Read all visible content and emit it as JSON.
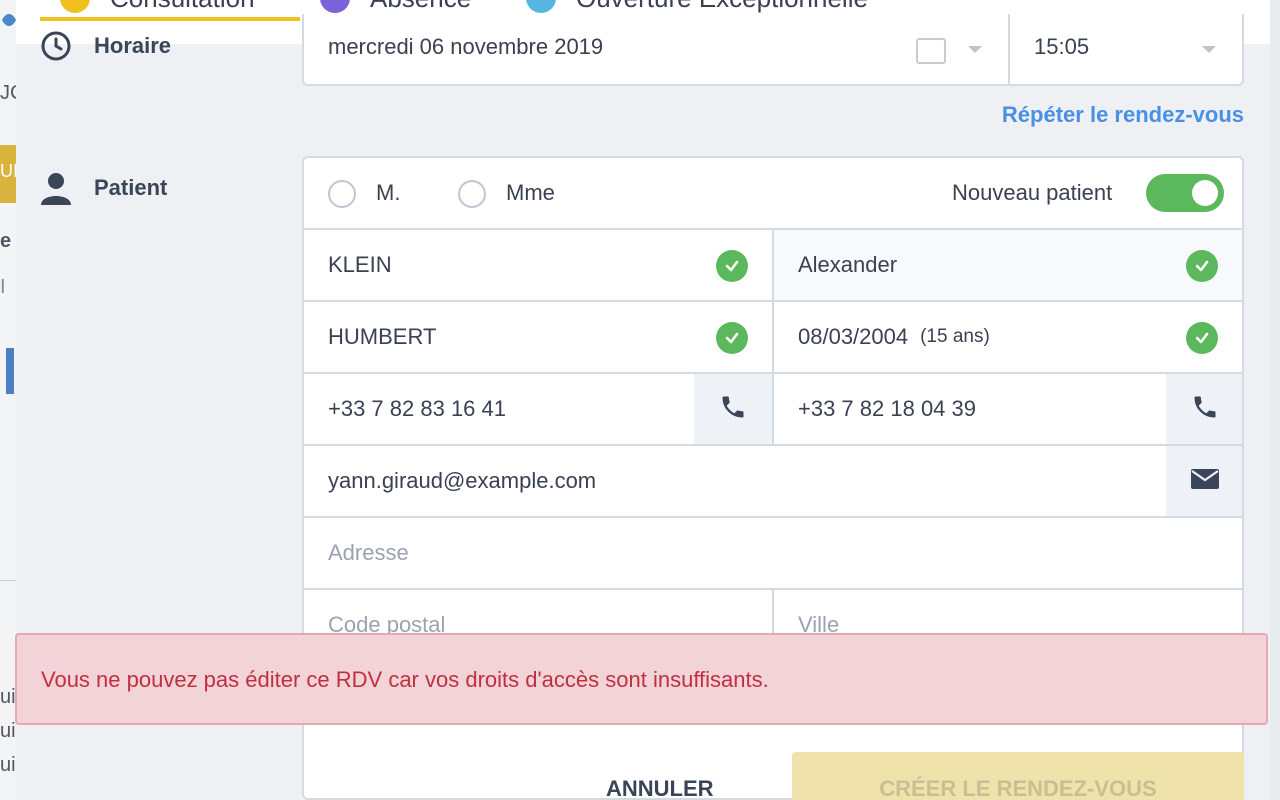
{
  "tabs": [
    {
      "label": "Consultation",
      "color": "#f0c01f"
    },
    {
      "label": "Absence",
      "color": "#7a62d8"
    },
    {
      "label": "Ouverture Exceptionnelle",
      "color": "#56b6e3"
    }
  ],
  "schedule": {
    "label": "Horaire",
    "date": "mercredi 06 novembre 2019",
    "time": "15:05",
    "repeat_link": "Répéter le rendez-vous"
  },
  "patient": {
    "label": "Patient",
    "civility_m": "M.",
    "civility_mme": "Mme",
    "new_patient_label": "Nouveau patient",
    "new_patient_enabled": true,
    "last_name": "KLEIN",
    "first_name": "Alexander",
    "maiden_name": "HUMBERT",
    "birth_date": "08/03/2004",
    "age": "(15 ans)",
    "phone1": "+33 7 82 83 16 41",
    "phone2": "+33 7 82 18 04 39",
    "email": "yann.giraud@example.com",
    "address_placeholder": "Adresse",
    "postal_code_placeholder": "Code postal",
    "city_placeholder": "Ville"
  },
  "alert": {
    "message": "Vous ne pouvez pas éditer ce RDV car vos droits d'accès sont insuffisants."
  },
  "footer": {
    "cancel_label": "ANNULER",
    "create_label": "CRÉER LE RENDEZ-VOUS"
  },
  "background_fragments": {
    "frag1": "JC",
    "frag2": "UI",
    "frag3": "e",
    "frag4": "I",
    "frag5": "ui",
    "frag6": "ui",
    "frag7": "ui"
  },
  "colors": {
    "accent": "#f0c01f",
    "success": "#5cb85c",
    "link": "#4a90e2",
    "error_text": "#c0303f",
    "error_bg": "#f2d3d8"
  }
}
